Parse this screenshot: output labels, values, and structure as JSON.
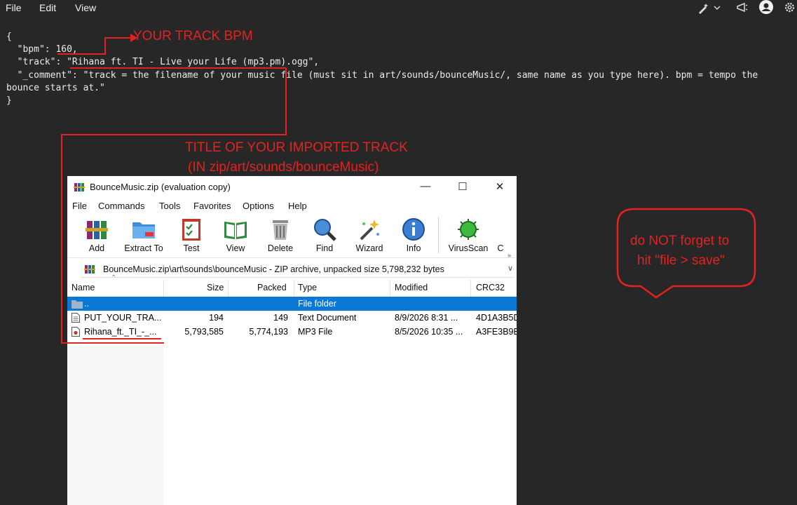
{
  "editor": {
    "menu": [
      "File",
      "Edit",
      "View"
    ],
    "lines": [
      "{",
      "  \"bpm\": 160,",
      "  \"track\": \"Rihana ft. TI - Live your Life (mp3.pm).ogg\",",
      "  \"_comment\": \"track = the filename of your music file (must sit in art/sounds/bounceMusic/, same name as you type here). bpm = tempo the bounce starts at.\"",
      "}"
    ]
  },
  "annotations": {
    "bpm_label": "YOUR TRACK BPM",
    "title_line1": "TITLE OF YOUR IMPORTED TRACK",
    "title_line2": "(IN zip/art/sounds/bounceMusic)",
    "save_line1": "do NOT forget to",
    "save_line2": "hit \"file > save\"",
    "color": "#e32222"
  },
  "winrar": {
    "title": "BounceMusic.zip (evaluation copy)",
    "menu": [
      "File",
      "Commands",
      "Tools",
      "Favorites",
      "Options",
      "Help"
    ],
    "toolbar": [
      "Add",
      "Extract To",
      "Test",
      "View",
      "Delete",
      "Find",
      "Wizard",
      "Info",
      "VirusScan",
      "C"
    ],
    "address": "BounceMusic.zip\\art\\sounds\\bounceMusic - ZIP archive, unpacked size 5,798,232 bytes",
    "columns": [
      "Name",
      "Size",
      "Packed",
      "Type",
      "Modified",
      "CRC32"
    ],
    "rows": [
      {
        "name": "..",
        "size": "",
        "packed": "",
        "type": "File folder",
        "modified": "",
        "crc": ""
      },
      {
        "name": "PUT_YOUR_TRA...",
        "size": "194",
        "packed": "149",
        "type": "Text Document",
        "modified": "8/9/2026 8:31 ...",
        "crc": "4D1A3B5D"
      },
      {
        "name": "Rihana_ft._TI_-_...",
        "size": "5,793,585",
        "packed": "5,774,193",
        "type": "MP3 File",
        "modified": "8/5/2026 10:35 ...",
        "crc": "A3FE3B9E"
      }
    ],
    "selected_color": "#0a78d7"
  }
}
